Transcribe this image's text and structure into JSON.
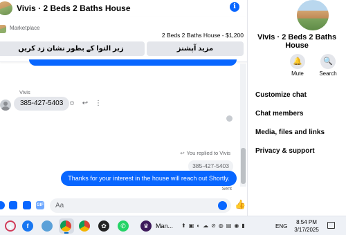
{
  "chat": {
    "title": "Vivis · 2 Beds 2 Baths House",
    "info_icon": "i",
    "marketplace": {
      "label": "Marketplace",
      "listing": "2 Beds 2 Baths House - $1,200",
      "button_left": "زیر التوا کے بطور نشان زد کریں",
      "button_right": "مزید آپشنز"
    },
    "incoming": {
      "sender": "Vivis",
      "text": "385-427-5403"
    },
    "reply_context": "You replied to Vivis",
    "quoted_text": "385-427-5403",
    "outgoing_text": "Thanks for your interest in the house will reach out Shortly.",
    "status": "Sent",
    "composer": {
      "placeholder": "Aa",
      "gif_label": "GIF"
    }
  },
  "side_panel": {
    "name": "Vivis · 2 Beds 2 Baths House",
    "buttons": [
      {
        "label": "Mute",
        "icon": "bell-icon"
      },
      {
        "label": "Search",
        "icon": "search-icon"
      }
    ],
    "menu": [
      "Customize chat",
      "Chat members",
      "Media, files and links",
      "Privacy & support"
    ]
  },
  "taskbar": {
    "app_label": "Man...",
    "language": "ENG",
    "time": "8:54 PM",
    "date": "3/17/2025",
    "icons": [
      "app-icon",
      "facebook-icon",
      "game-icon",
      "chrome-icon",
      "chrome-icon",
      "chatgpt-icon",
      "whatsapp-icon",
      "premier-league-icon"
    ]
  },
  "colors": {
    "accent": "#0866ff",
    "bubble_gray": "#e4e6eb"
  }
}
